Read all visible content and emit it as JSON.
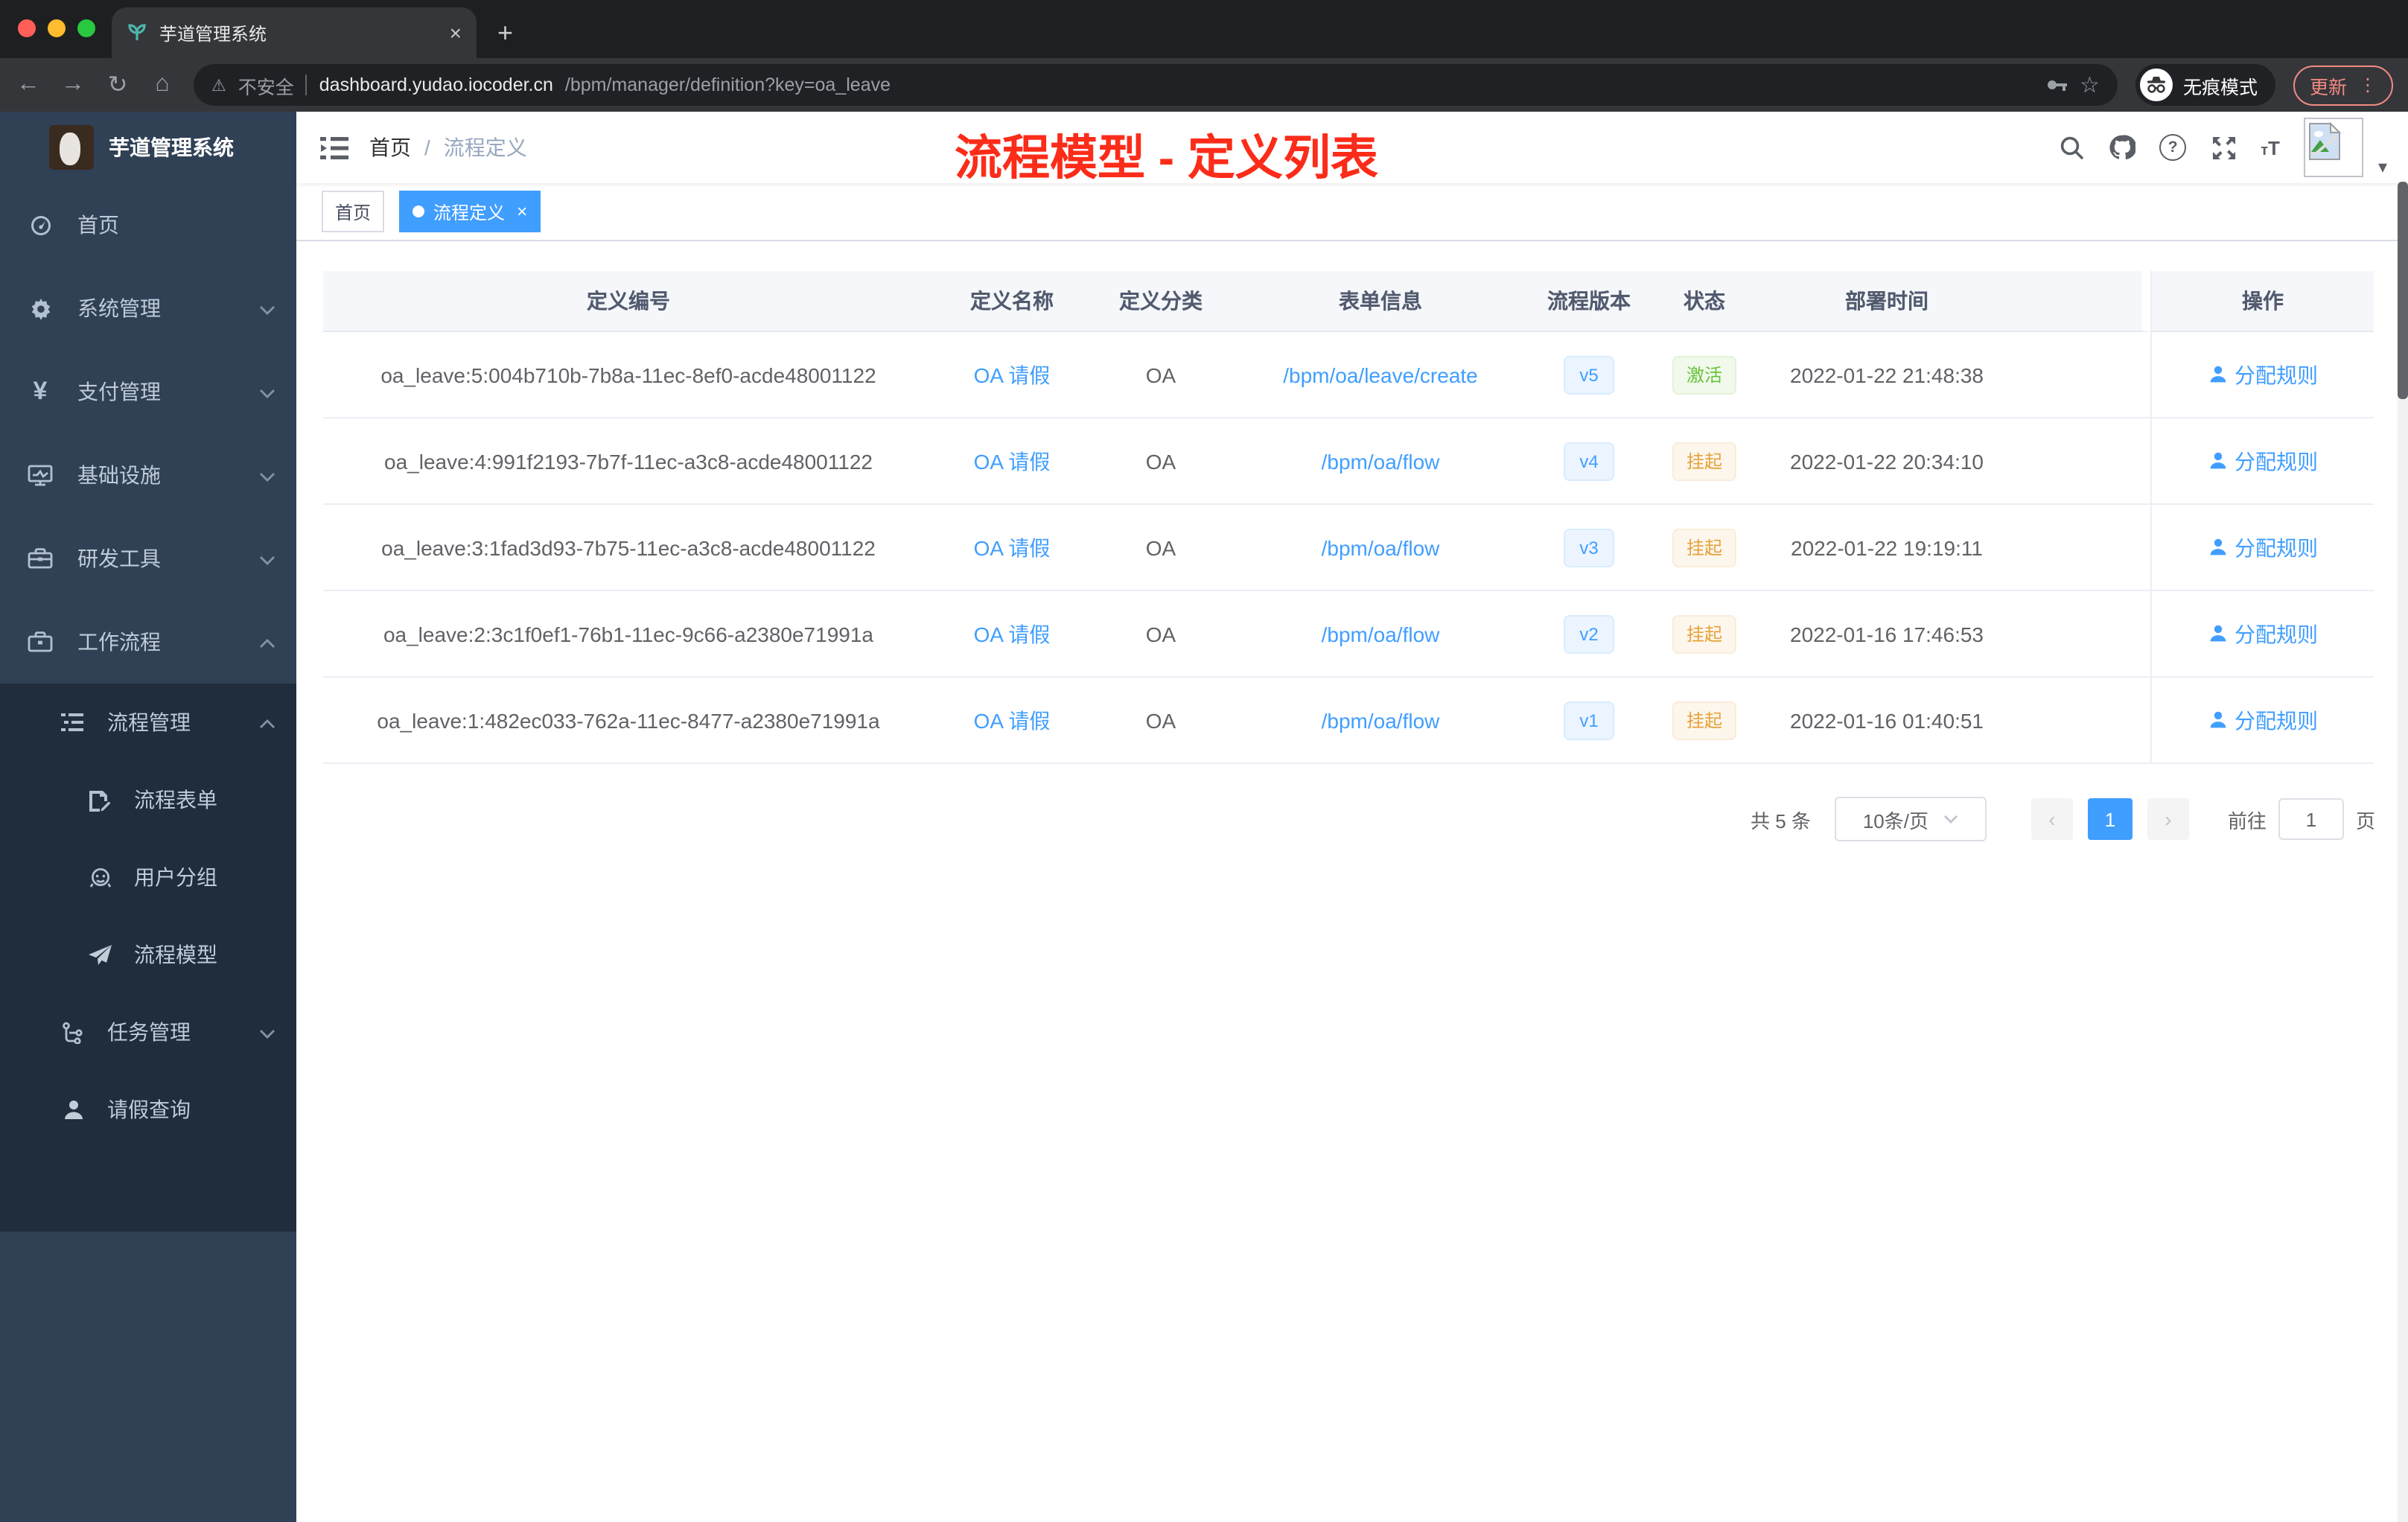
{
  "browser": {
    "tab_title": "芋道管理系统",
    "security_label": "不安全",
    "url_domain": "dashboard.yudao.iocoder.cn",
    "url_path": "/bpm/manager/definition?key=oa_leave",
    "incognito_label": "无痕模式",
    "update_label": "更新"
  },
  "icons": {
    "close": "×",
    "plus": "+",
    "back": "←",
    "forward": "→",
    "reload": "↻",
    "home": "⌂",
    "warning": "⚠",
    "star": "☆",
    "more": "⋮",
    "caret_down": "▾",
    "help": "?",
    "font_size_small": "т",
    "font_size_big": "T",
    "prev": "‹",
    "next": "›",
    "breadcrumb_sep": "/",
    "yuan": "¥"
  },
  "sidebar": {
    "title": "芋道管理系统",
    "menu": [
      {
        "label": "首页"
      },
      {
        "label": "系统管理"
      },
      {
        "label": "支付管理"
      },
      {
        "label": "基础设施"
      },
      {
        "label": "研发工具"
      },
      {
        "label": "工作流程"
      }
    ],
    "workflow_submenu": [
      {
        "label": "流程管理"
      },
      {
        "label": "流程表单"
      },
      {
        "label": "用户分组"
      },
      {
        "label": "流程模型"
      },
      {
        "label": "任务管理"
      },
      {
        "label": "请假查询"
      }
    ]
  },
  "header": {
    "breadcrumb_home": "首页",
    "breadcrumb_current": "流程定义",
    "annotation": "流程模型 - 定义列表",
    "annotation_color": "#fb2c19"
  },
  "tags": [
    {
      "label": "首页"
    },
    {
      "label": "流程定义",
      "active": true
    }
  ],
  "table": {
    "columns": [
      "定义编号",
      "定义名称",
      "定义分类",
      "表单信息",
      "流程版本",
      "状态",
      "部署时间",
      "操作"
    ],
    "rows": [
      {
        "id": "oa_leave:5:004b710b-7b8a-11ec-8ef0-acde48001122",
        "name": "OA 请假",
        "category": "OA",
        "form": "/bpm/oa/leave/create",
        "version": "v5",
        "status": "激活",
        "status_type": "success",
        "deploy_time": "2022-01-22 21:48:38",
        "action": "分配规则"
      },
      {
        "id": "oa_leave:4:991f2193-7b7f-11ec-a3c8-acde48001122",
        "name": "OA 请假",
        "category": "OA",
        "form": "/bpm/oa/flow",
        "version": "v4",
        "status": "挂起",
        "status_type": "warning",
        "deploy_time": "2022-01-22 20:34:10",
        "action": "分配规则"
      },
      {
        "id": "oa_leave:3:1fad3d93-7b75-11ec-a3c8-acde48001122",
        "name": "OA 请假",
        "category": "OA",
        "form": "/bpm/oa/flow",
        "version": "v3",
        "status": "挂起",
        "status_type": "warning",
        "deploy_time": "2022-01-22 19:19:11",
        "action": "分配规则"
      },
      {
        "id": "oa_leave:2:3c1f0ef1-76b1-11ec-9c66-a2380e71991a",
        "name": "OA 请假",
        "category": "OA",
        "form": "/bpm/oa/flow",
        "version": "v2",
        "status": "挂起",
        "status_type": "warning",
        "deploy_time": "2022-01-16 17:46:53",
        "action": "分配规则"
      },
      {
        "id": "oa_leave:1:482ec033-762a-11ec-8477-a2380e71991a",
        "name": "OA 请假",
        "category": "OA",
        "form": "/bpm/oa/flow",
        "version": "v1",
        "status": "挂起",
        "status_type": "warning",
        "deploy_time": "2022-01-16 01:40:51",
        "action": "分配规则"
      }
    ]
  },
  "pagination": {
    "total_label": "共 5 条",
    "page_size": "10条/页",
    "current_page": "1",
    "goto_label": "前往",
    "goto_value": "1",
    "page_unit": "页"
  },
  "colors": {
    "accent": "#409eff",
    "success": "#67c23a",
    "warning": "#e6a23c",
    "sidebar_bg": "#304156",
    "sidebar_submenu_bg": "#1f2d3d",
    "chrome_bg": "#35363a"
  }
}
